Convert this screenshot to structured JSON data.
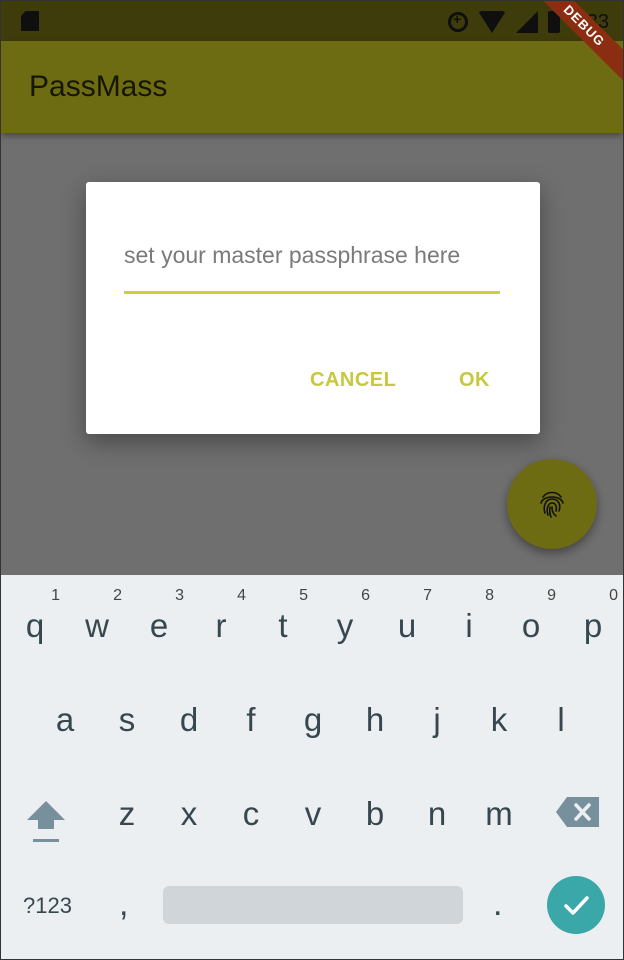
{
  "status_bar": {
    "time": "9:33",
    "icons": [
      "sd-card-icon",
      "data-saver-icon",
      "wifi-icon",
      "signal-icon",
      "battery-icon"
    ]
  },
  "app_bar": {
    "title": "PassMass"
  },
  "debug_banner": {
    "label": "DEBUG"
  },
  "dialog": {
    "input_placeholder": "set your master passphrase here",
    "input_value": "",
    "cancel_label": "CANCEL",
    "ok_label": "OK"
  },
  "fab": {
    "icon": "fingerprint-icon"
  },
  "keyboard": {
    "row1": [
      {
        "key": "q",
        "hint": "1"
      },
      {
        "key": "w",
        "hint": "2"
      },
      {
        "key": "e",
        "hint": "3"
      },
      {
        "key": "r",
        "hint": "4"
      },
      {
        "key": "t",
        "hint": "5"
      },
      {
        "key": "y",
        "hint": "6"
      },
      {
        "key": "u",
        "hint": "7"
      },
      {
        "key": "i",
        "hint": "8"
      },
      {
        "key": "o",
        "hint": "9"
      },
      {
        "key": "p",
        "hint": "0"
      }
    ],
    "row2": [
      "a",
      "s",
      "d",
      "f",
      "g",
      "h",
      "j",
      "k",
      "l"
    ],
    "row3": [
      "z",
      "x",
      "c",
      "v",
      "b",
      "n",
      "m"
    ],
    "num_label": "?123",
    "comma": ",",
    "period": ".",
    "shift_icon": "shift-icon",
    "delete_icon": "backspace-icon",
    "enter_icon": "checkmark-icon"
  },
  "colors": {
    "primary": "#6e6c12",
    "accent": "#c8c840",
    "scrim": "#6f6f6f",
    "keyboard_bg": "#eceff1",
    "enter": "#3aa7a8"
  }
}
